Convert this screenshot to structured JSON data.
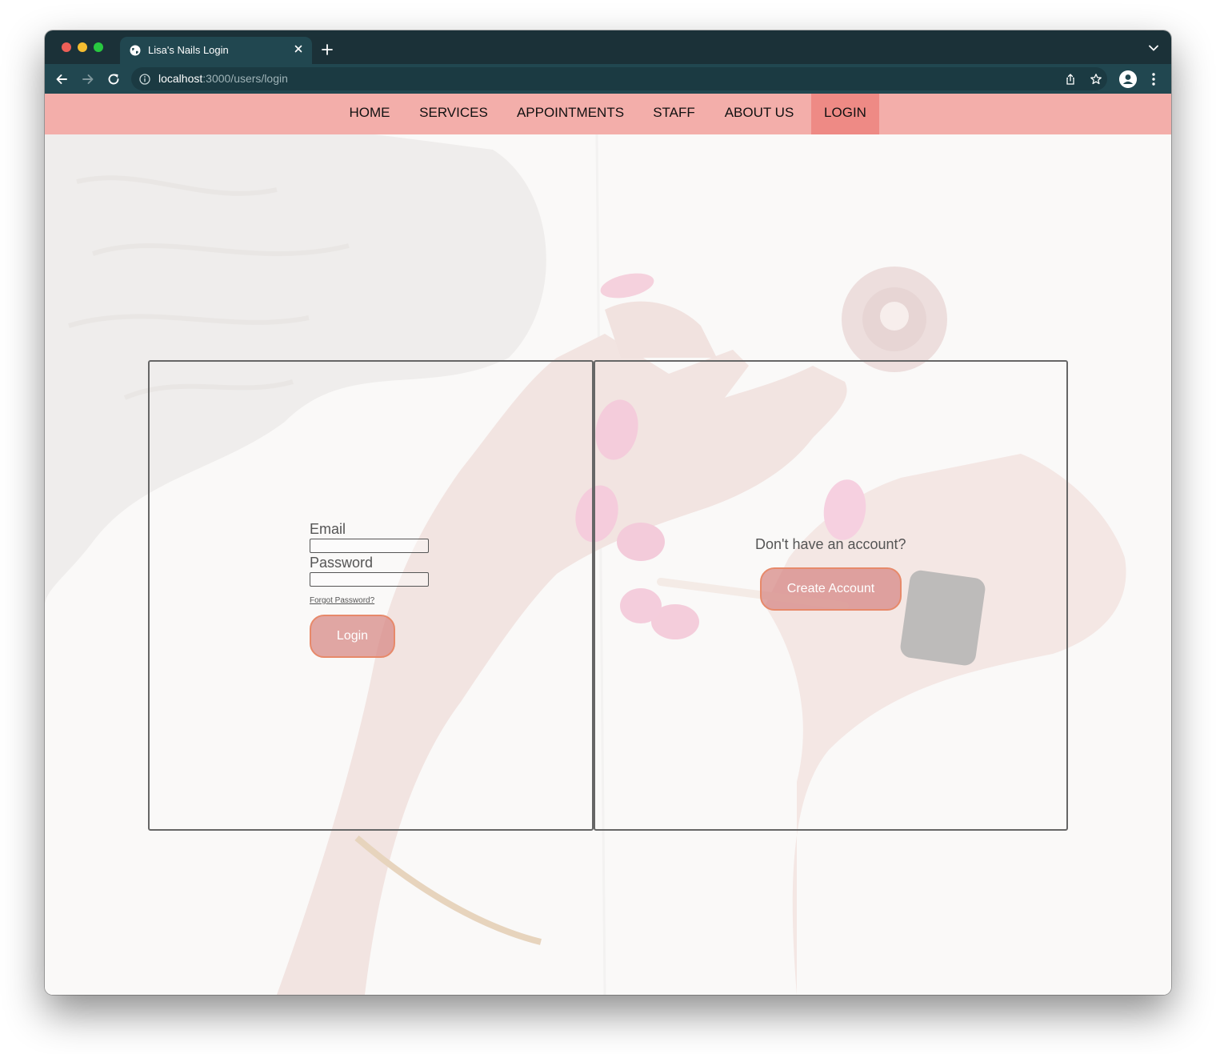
{
  "browser": {
    "tab_title": "Lisa's Nails Login",
    "url_host": "localhost",
    "url_path": ":3000/users/login"
  },
  "nav": {
    "items": [
      "HOME",
      "SERVICES",
      "APPOINTMENTS",
      "STAFF",
      "ABOUT US",
      "LOGIN"
    ],
    "active": "LOGIN"
  },
  "login": {
    "email_label": "Email",
    "password_label": "Password",
    "email_value": "",
    "password_value": "",
    "forgot_link": "Forgot Password?",
    "submit_label": "Login"
  },
  "signup": {
    "prompt": "Don't have an account?",
    "button_label": "Create Account"
  },
  "colors": {
    "chrome_dark": "#1b3138",
    "chrome_toolbar": "#214750",
    "navbar": "#f3aeaa",
    "nav_active": "#ee8a85",
    "button_fill": "#d68582",
    "button_border": "#e7896a"
  },
  "background": {
    "subject": "hands with pink nail polish and nail polish bottle on white fur"
  }
}
